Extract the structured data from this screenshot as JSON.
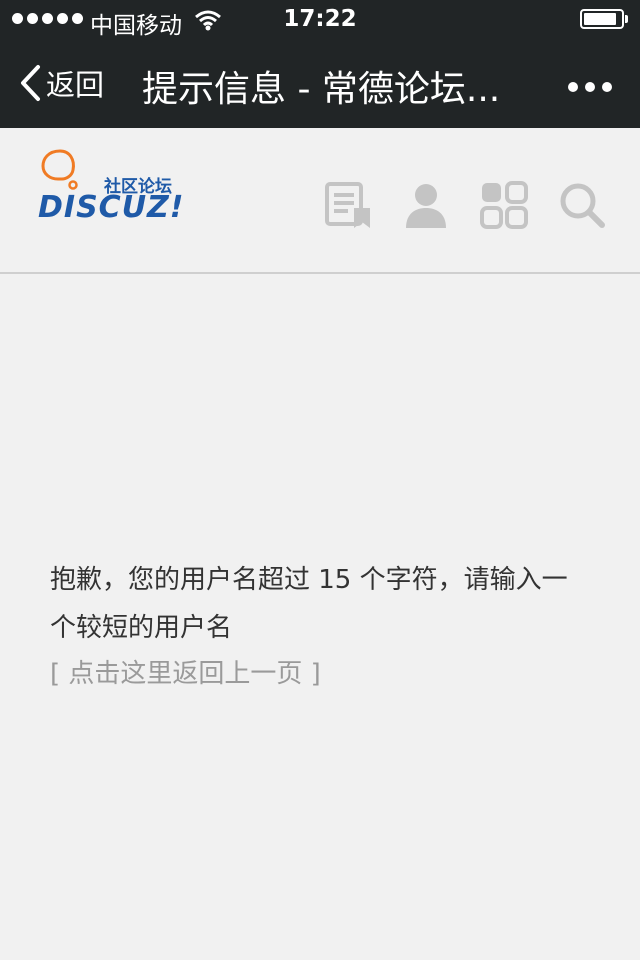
{
  "status_bar": {
    "carrier": "中国移动",
    "time": "17:22",
    "battery_level": 0.9
  },
  "nav_bar": {
    "back_label": "返回",
    "title": "提示信息 - 常德论坛..."
  },
  "site_header": {
    "logo_tag": "社区论坛",
    "logo_word": "DISCUZ!"
  },
  "message": {
    "text": "抱歉，您的用户名超过 15 个字符，请输入一个较短的用户名",
    "back_link": "[ 点击这里返回上一页 ]"
  },
  "colors": {
    "top_bar": "#212526",
    "page_background": "#f1f1f1",
    "logo_blue": "#1f5aa8",
    "logo_orange": "#f07b24",
    "icon_gray": "#c4c4c4"
  }
}
